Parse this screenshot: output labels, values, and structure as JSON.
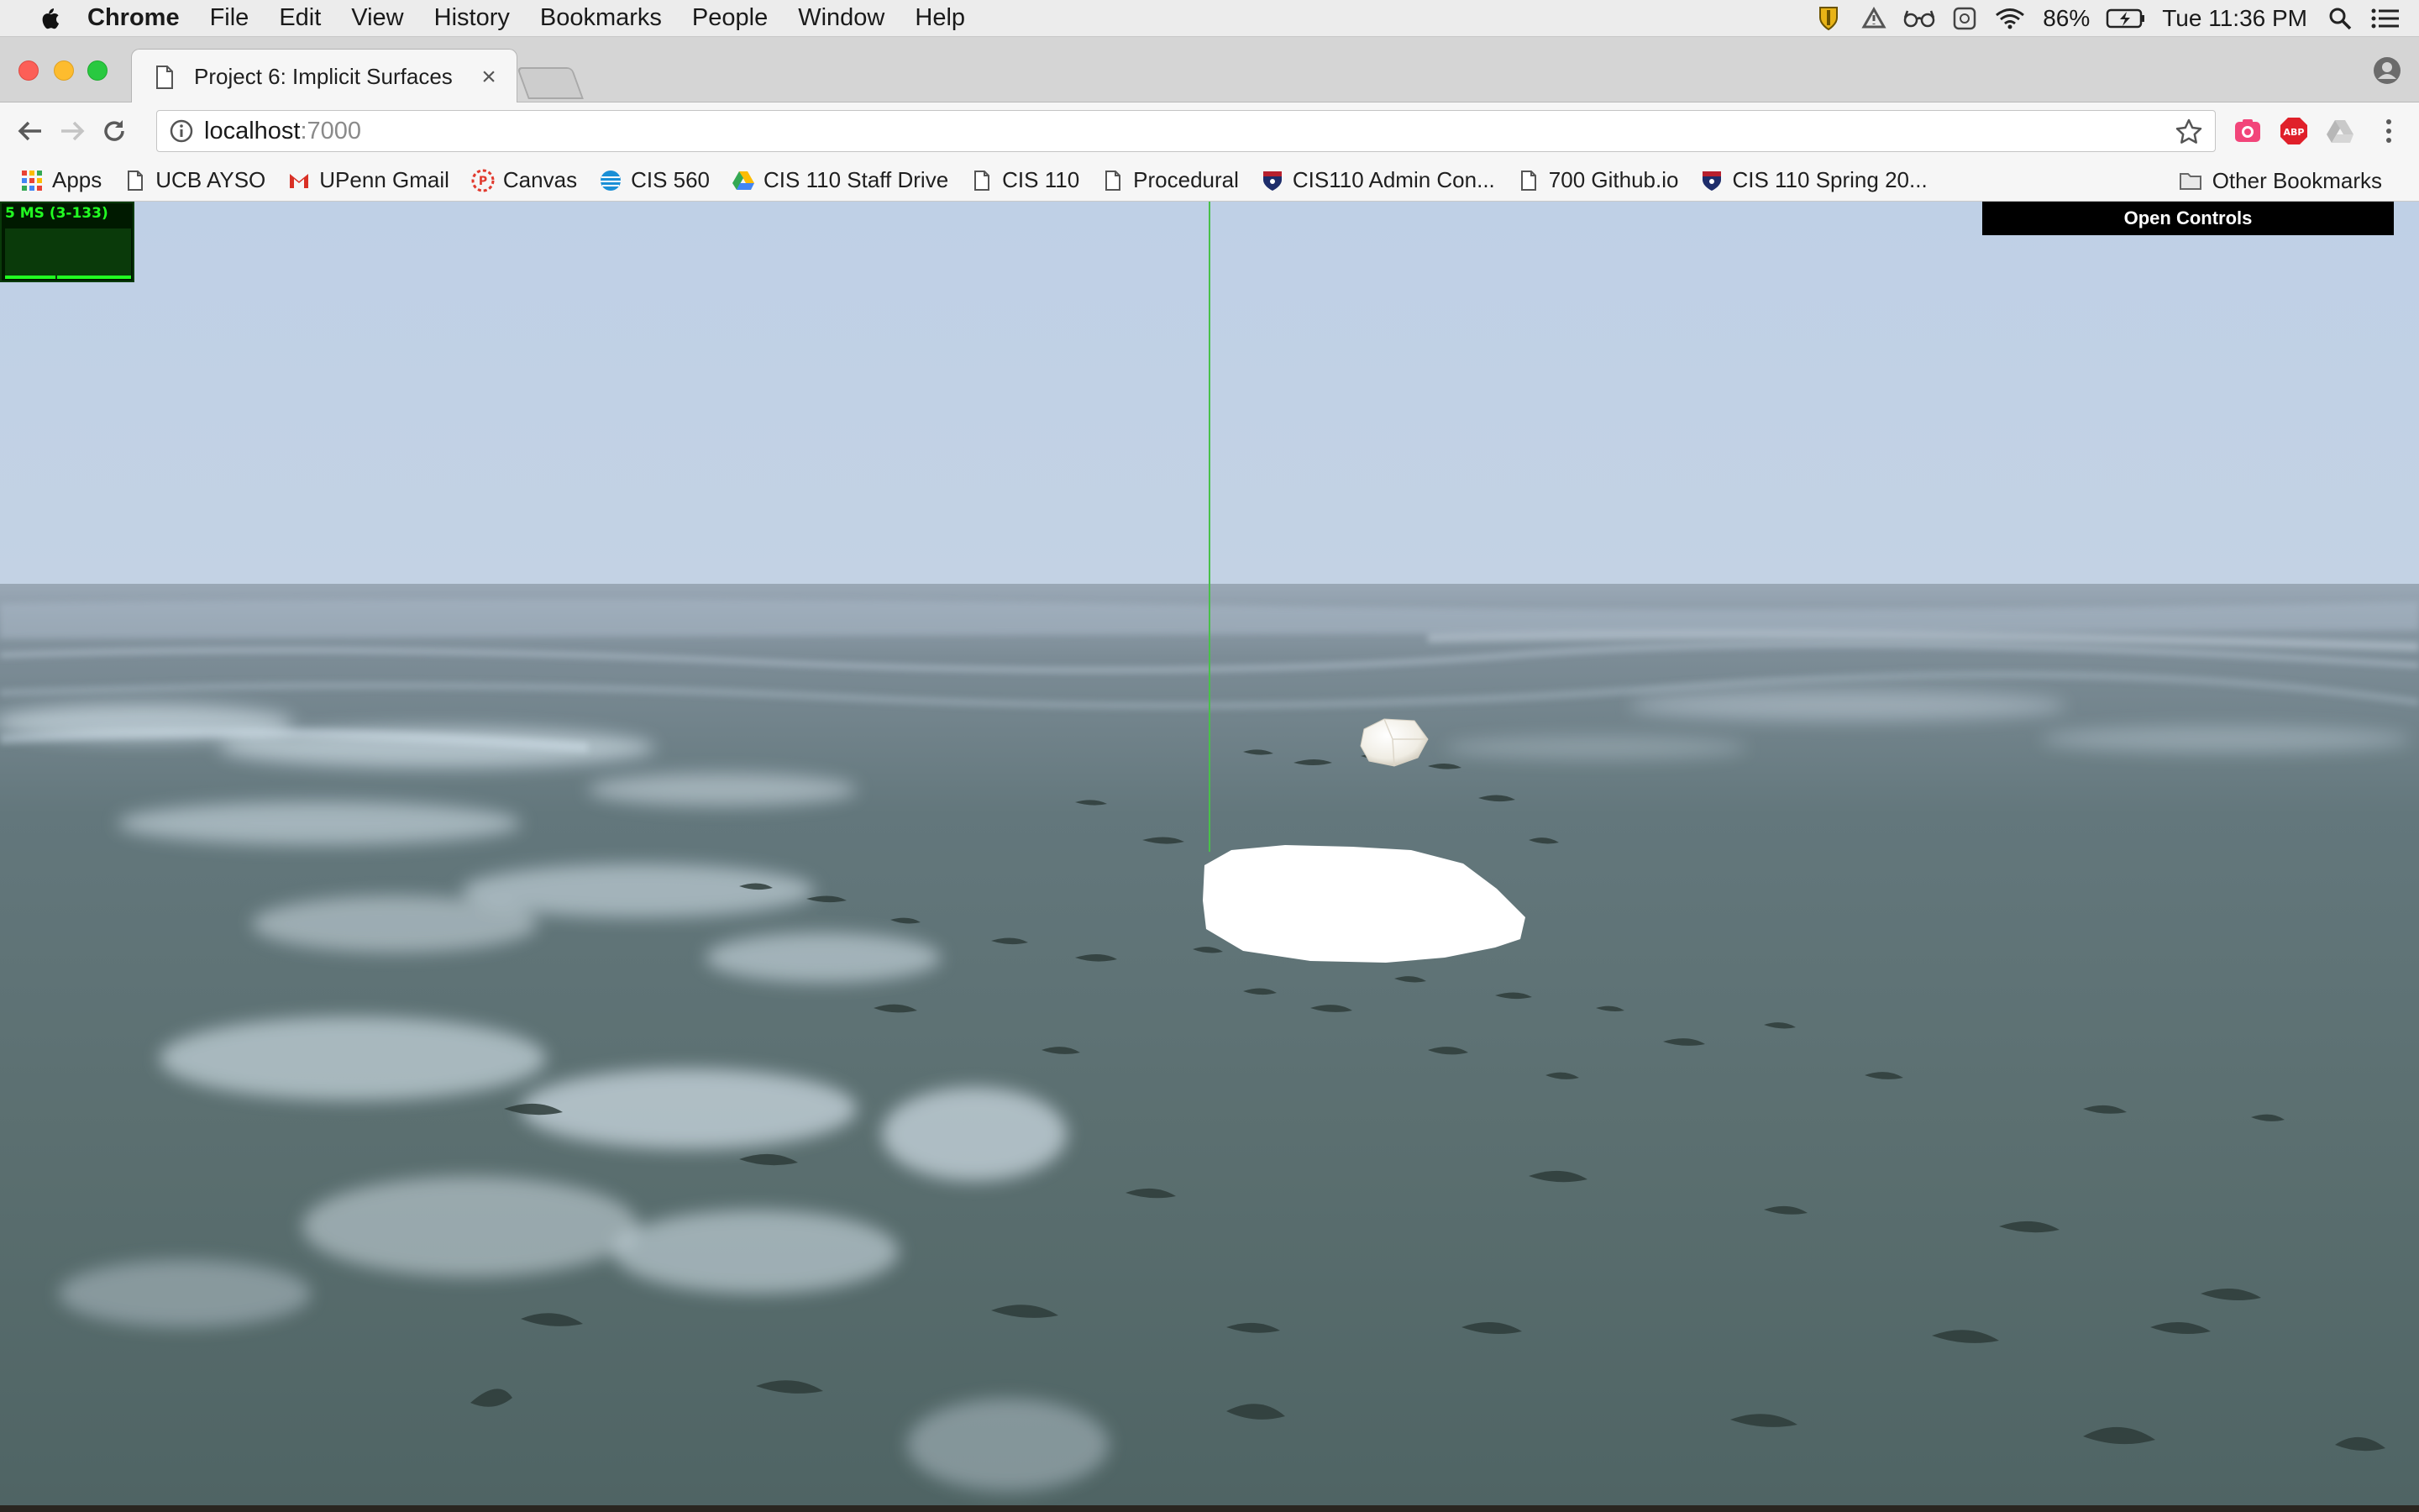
{
  "menubar": {
    "apple_icon": "apple-logo-icon",
    "app_name": "Chrome",
    "items": [
      "File",
      "Edit",
      "View",
      "History",
      "Bookmarks",
      "People",
      "Window",
      "Help"
    ],
    "battery_percent": "86%",
    "clock": "Tue 11:36 PM",
    "status_icons": [
      "norton-shield-icon",
      "google-drive-icon",
      "glasses-icon",
      "screen-capture-icon",
      "wifi-icon",
      "battery-charging-icon",
      "spotlight-search-icon",
      "notification-center-icon"
    ]
  },
  "tab": {
    "title": "Project 6: Implicit Surfaces",
    "close_glyph": "×"
  },
  "omnibox": {
    "host": "localhost",
    "port": ":7000"
  },
  "bookmarks": {
    "items": [
      {
        "label": "Apps",
        "icon": "apps-grid-icon"
      },
      {
        "label": "UCB AYSO",
        "icon": "page-icon"
      },
      {
        "label": "UPenn Gmail",
        "icon": "gmail-icon"
      },
      {
        "label": "Canvas",
        "icon": "canvas-icon"
      },
      {
        "label": "CIS 560",
        "icon": "att-globe-icon"
      },
      {
        "label": "CIS 110 Staff Drive",
        "icon": "google-drive-icon"
      },
      {
        "label": "CIS 110",
        "icon": "page-icon"
      },
      {
        "label": "Procedural",
        "icon": "page-icon"
      },
      {
        "label": "CIS110 Admin Con...",
        "icon": "penn-shield-icon"
      },
      {
        "label": "700 Github.io",
        "icon": "page-icon"
      },
      {
        "label": "CIS 110 Spring 20...",
        "icon": "penn-shield-icon"
      }
    ],
    "other": "Other Bookmarks"
  },
  "viewport": {
    "stats_label": "5 MS (3-133)",
    "controls_label": "Open Controls",
    "colors": {
      "sky": "#bfd0e6",
      "water": "#5a6e6f",
      "foam": "#e6f2fb",
      "stats_green": "#22ff22"
    }
  }
}
